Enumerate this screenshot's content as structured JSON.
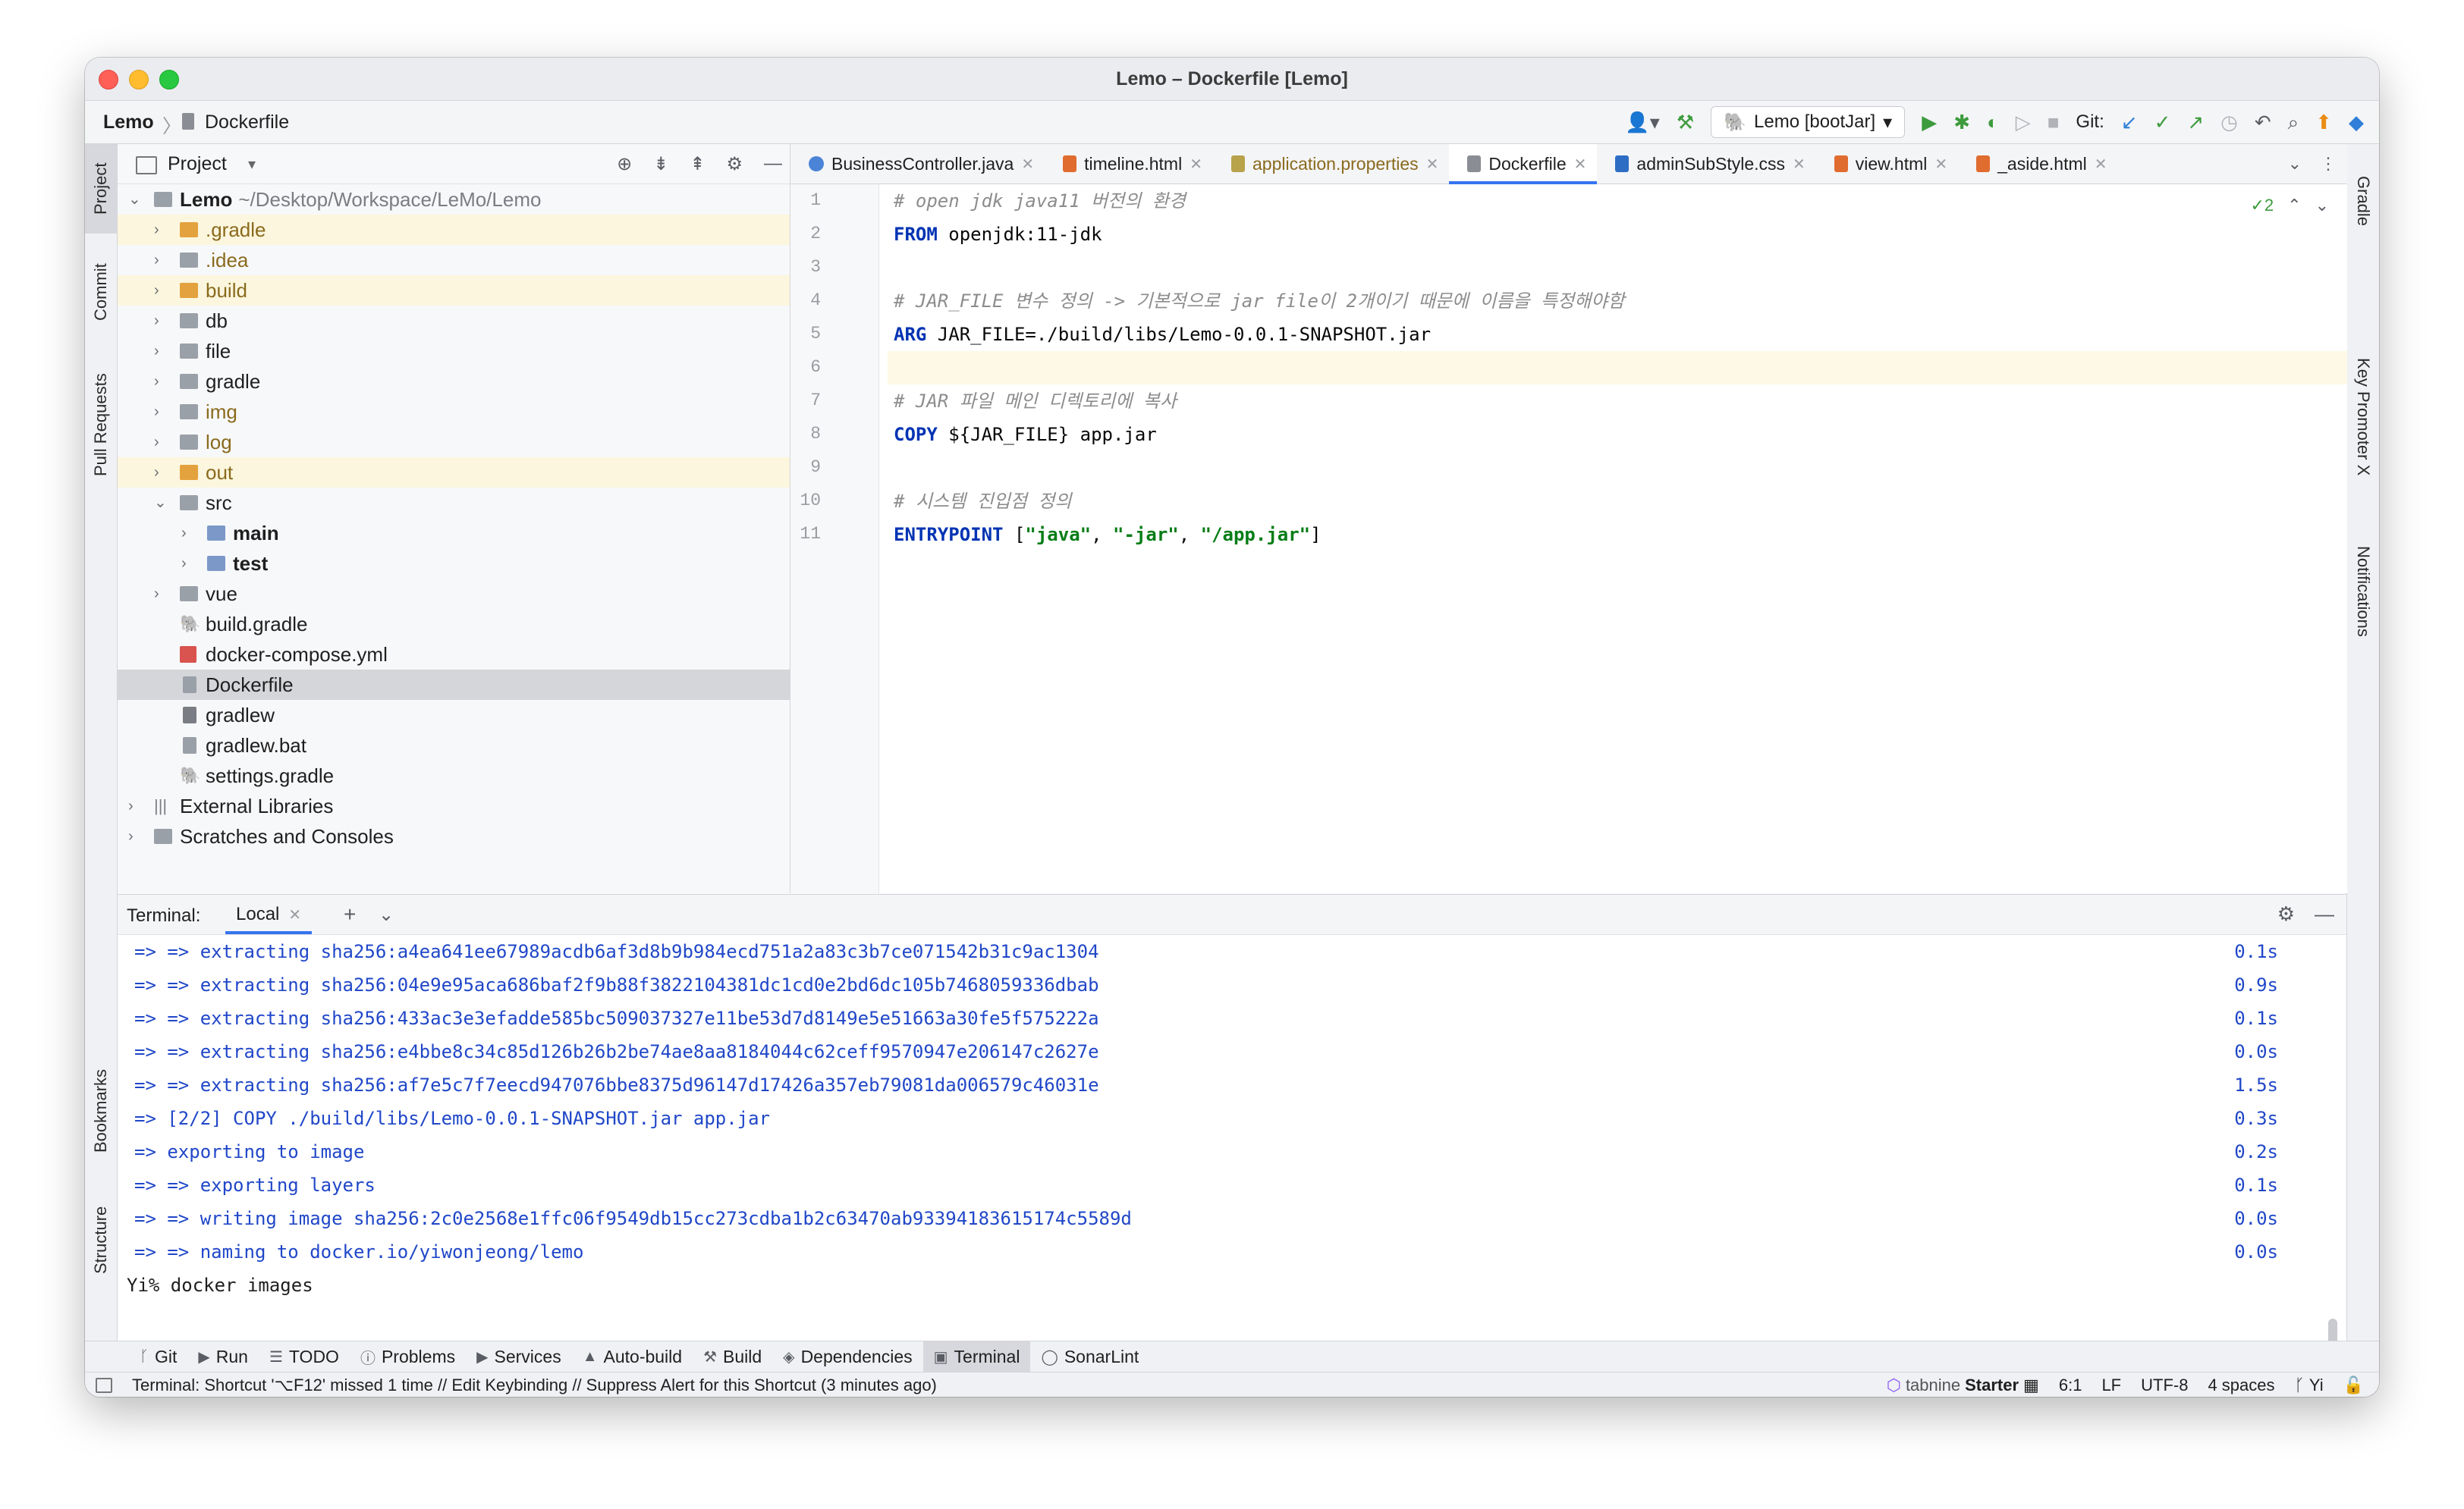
{
  "window": {
    "title": "Lemo – Dockerfile [Lemo]"
  },
  "navbar": {
    "project": "Lemo",
    "separator": "〉",
    "file": "Dockerfile",
    "run_config": "Lemo [bootJar]",
    "git_label": "Git:"
  },
  "left_stripe": {
    "tabs": [
      "Project",
      "Commit",
      "Pull Requests",
      "Bookmarks",
      "Structure"
    ]
  },
  "right_stripe": {
    "tabs": [
      "Gradle",
      "Key Promoter X",
      "Notifications"
    ]
  },
  "project_panel": {
    "title": "Project",
    "root": {
      "name": "Lemo",
      "path": "~/Desktop/Workspace/LeMo/Lemo"
    },
    "items": [
      {
        "label": ".gradle",
        "kind": "folder"
      },
      {
        "label": ".idea",
        "kind": "folder"
      },
      {
        "label": "build",
        "kind": "folder"
      },
      {
        "label": "db",
        "kind": "folder"
      },
      {
        "label": "file",
        "kind": "folder"
      },
      {
        "label": "gradle",
        "kind": "folder"
      },
      {
        "label": "img",
        "kind": "folder"
      },
      {
        "label": "log",
        "kind": "folder"
      },
      {
        "label": "out",
        "kind": "folder"
      },
      {
        "label": "src",
        "kind": "folder"
      },
      {
        "label": "main",
        "kind": "folder"
      },
      {
        "label": "test",
        "kind": "folder"
      },
      {
        "label": "vue",
        "kind": "folder"
      },
      {
        "label": "build.gradle",
        "kind": "file"
      },
      {
        "label": "docker-compose.yml",
        "kind": "file"
      },
      {
        "label": "Dockerfile",
        "kind": "file"
      },
      {
        "label": "gradlew",
        "kind": "file"
      },
      {
        "label": "gradlew.bat",
        "kind": "file"
      },
      {
        "label": "settings.gradle",
        "kind": "file"
      },
      {
        "label": "External Libraries",
        "kind": "library"
      },
      {
        "label": "Scratches and Consoles",
        "kind": "scratch"
      }
    ]
  },
  "editor": {
    "tabs": [
      {
        "label": "BusinessController.java"
      },
      {
        "label": "timeline.html"
      },
      {
        "label": "application.properties"
      },
      {
        "label": "Dockerfile"
      },
      {
        "label": "adminSubStyle.css"
      },
      {
        "label": "view.html"
      },
      {
        "label": "_aside.html"
      }
    ],
    "inspection_count": "2",
    "line_numbers": [
      "1",
      "2",
      "3",
      "4",
      "5",
      "6",
      "7",
      "8",
      "9",
      "10",
      "11"
    ],
    "lines": {
      "l1": "# open jdk java11 버전의 환경",
      "l2_kw": "FROM",
      "l2_rest": " openjdk:11-jdk",
      "l4": "# JAR_FILE 변수 정의 -> 기본적으로 jar file이 2개이기 때문에 이름을 특정해야함",
      "l5_kw": "ARG",
      "l5_rest": " JAR_FILE=./build/libs/Lemo-0.0.1-SNAPSHOT.jar",
      "l7": "# JAR 파일 메인 디렉토리에 복사",
      "l8_kw": "COPY",
      "l8_rest": " ${JAR_FILE} app.jar",
      "l10": "# 시스템 진입점 정의",
      "l11_kw": "ENTRYPOINT",
      "l11_open": " [",
      "l11_s1": "\"java\"",
      "l11_c1": ", ",
      "l11_s2": "\"-jar\"",
      "l11_c2": ", ",
      "l11_s3": "\"/app.jar\"",
      "l11_close": "]"
    }
  },
  "terminal": {
    "title": "Terminal:",
    "tab": "Local",
    "lines": [
      {
        "text": "=> => extracting sha256:a4ea641ee67989acdb6af3d8b9b984ecd751a2a83c3b7ce071542b31c9ac1304",
        "time": "0.1s"
      },
      {
        "text": "=> => extracting sha256:04e9e95aca686baf2f9b88f3822104381dc1cd0e2bd6dc105b7468059336dbab",
        "time": "0.9s"
      },
      {
        "text": "=> => extracting sha256:433ac3e3efadde585bc509037327e11be53d7d8149e5e51663a30fe5f575222a",
        "time": "0.1s"
      },
      {
        "text": "=> => extracting sha256:e4bbe8c34c85d126b26b2be74ae8aa8184044c62ceff9570947e206147c2627e",
        "time": "0.0s"
      },
      {
        "text": "=> => extracting sha256:af7e5c7f7eecd947076bbe8375d96147d17426a357eb79081da006579c46031e",
        "time": "1.5s"
      },
      {
        "text": "=> [2/2] COPY ./build/libs/Lemo-0.0.1-SNAPSHOT.jar app.jar",
        "time": "0.3s"
      },
      {
        "text": "=> exporting to image",
        "time": "0.2s"
      },
      {
        "text": "=> => exporting layers",
        "time": "0.1s"
      },
      {
        "text": "=> => writing image sha256:2c0e2568e1ffc06f9549db15cc273cdba1b2c63470ab93394183615174c5589d",
        "time": "0.0s"
      },
      {
        "text": "=> => naming to docker.io/yiwonjeong/lemo",
        "time": "0.0s"
      }
    ],
    "prompt": "Yi% docker images"
  },
  "bottom_tools": [
    {
      "label": "Git",
      "icon": "git-icon"
    },
    {
      "label": "Run",
      "icon": "run-icon"
    },
    {
      "label": "TODO",
      "icon": "todo-icon"
    },
    {
      "label": "Problems",
      "icon": "problems-icon"
    },
    {
      "label": "Services",
      "icon": "services-icon"
    },
    {
      "label": "Auto-build",
      "icon": "auto-build-icon"
    },
    {
      "label": "Build",
      "icon": "build-icon"
    },
    {
      "label": "Dependencies",
      "icon": "dependencies-icon"
    },
    {
      "label": "Terminal",
      "icon": "terminal-icon"
    },
    {
      "label": "SonarLint",
      "icon": "sonarlint-icon"
    }
  ],
  "status": {
    "message": "Terminal: Shortcut '⌥F12' missed 1 time // Edit Keybinding // Suppress Alert for this Shortcut (3 minutes ago)",
    "tabnine_name": "tabnine",
    "tabnine_plan": "Starter",
    "position": "6:1",
    "line_sep": "LF",
    "encoding": "UTF-8",
    "indent": "4 spaces",
    "branch": "Yi"
  },
  "colors": {
    "accent": "#3574f0",
    "terminal_text": "#2047c8",
    "keyword": "#0033b3",
    "string": "#067d17",
    "comment": "#8c8c8c"
  }
}
